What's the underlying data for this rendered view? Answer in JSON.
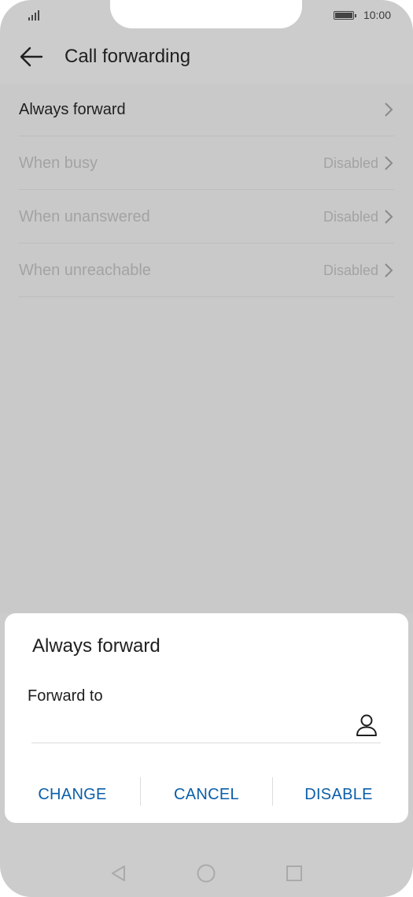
{
  "status_bar": {
    "time": "10:00"
  },
  "header": {
    "title": "Call forwarding"
  },
  "list": {
    "items": [
      {
        "label": "Always forward",
        "status": ""
      },
      {
        "label": "When busy",
        "status": "Disabled"
      },
      {
        "label": "When unanswered",
        "status": "Disabled"
      },
      {
        "label": "When unreachable",
        "status": "Disabled"
      }
    ]
  },
  "dialog": {
    "title": "Always forward",
    "field_label": "Forward to",
    "field_value": "",
    "actions": {
      "change": "CHANGE",
      "cancel": "CANCEL",
      "disable": "DISABLE"
    }
  },
  "colors": {
    "accent": "#0b5ea8",
    "scrim": "#cccccc"
  },
  "icons": {
    "back": "arrow-left-icon",
    "chevron": "chevron-right-icon",
    "contact": "person-icon",
    "nav_back": "triangle-back-icon",
    "nav_home": "circle-home-icon",
    "nav_recent": "square-recent-icon"
  }
}
